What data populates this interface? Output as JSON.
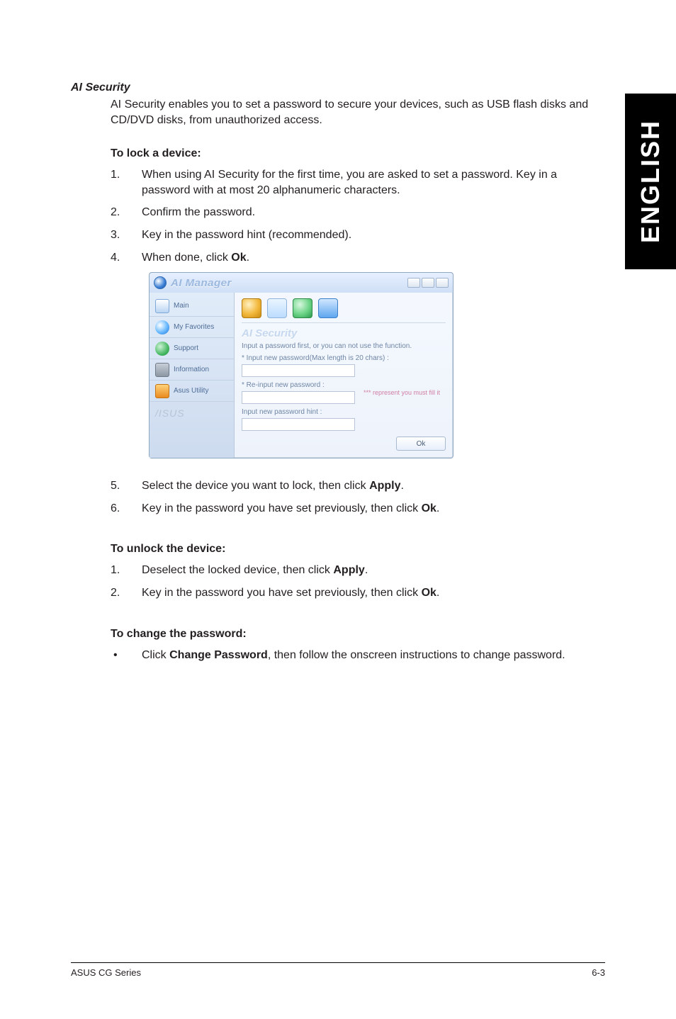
{
  "sideTab": {
    "language": "ENGLISH"
  },
  "section": {
    "title": "AI Security",
    "intro": "AI Security enables you to set a password to secure your devices, such as USB flash disks and CD/DVD disks, from unauthorized access."
  },
  "lock": {
    "heading": "To lock a device:",
    "steps1to4": [
      "When using AI Security for the first time, you are asked to set a password. Key in a password with at most 20 alphanumeric characters.",
      "Confirm the password.",
      "Key in the password hint (recommended).",
      {
        "pre": "When done, click ",
        "bold": "Ok",
        "post": "."
      }
    ],
    "steps5to6": [
      {
        "pre": "Select the device you want to lock, then click ",
        "bold": "Apply",
        "post": "."
      },
      {
        "pre": "Key in the password you have set previously, then click ",
        "bold": "Ok",
        "post": "."
      }
    ]
  },
  "unlock": {
    "heading": "To unlock the device:",
    "steps": [
      {
        "pre": "Deselect the locked device, then click ",
        "bold": "Apply",
        "post": "."
      },
      {
        "pre": "Key in the password you have set previously, then click ",
        "bold": "Ok",
        "post": "."
      }
    ]
  },
  "change": {
    "heading": "To change the password:",
    "bullet": {
      "pre": "Click ",
      "bold": "Change Password",
      "post": ", then follow the onscreen instructions to change password."
    }
  },
  "dialog": {
    "title": "AI Manager",
    "side": [
      "Main",
      "My Favorites",
      "Support",
      "Information",
      "Asus Utility"
    ],
    "brand": "/ISUS",
    "panelTitle": "AI Security",
    "subtext": "Input a password first, or you can not use the function.",
    "fields": {
      "newPassword": "* Input new password(Max length is 20 chars) :",
      "reinput": "* Re-input new password :",
      "hintNote": "*** represent you must fill it",
      "hint": "Input new password hint :"
    },
    "ok": "Ok"
  },
  "footer": {
    "left": "ASUS CG Series",
    "right": "6-3"
  }
}
